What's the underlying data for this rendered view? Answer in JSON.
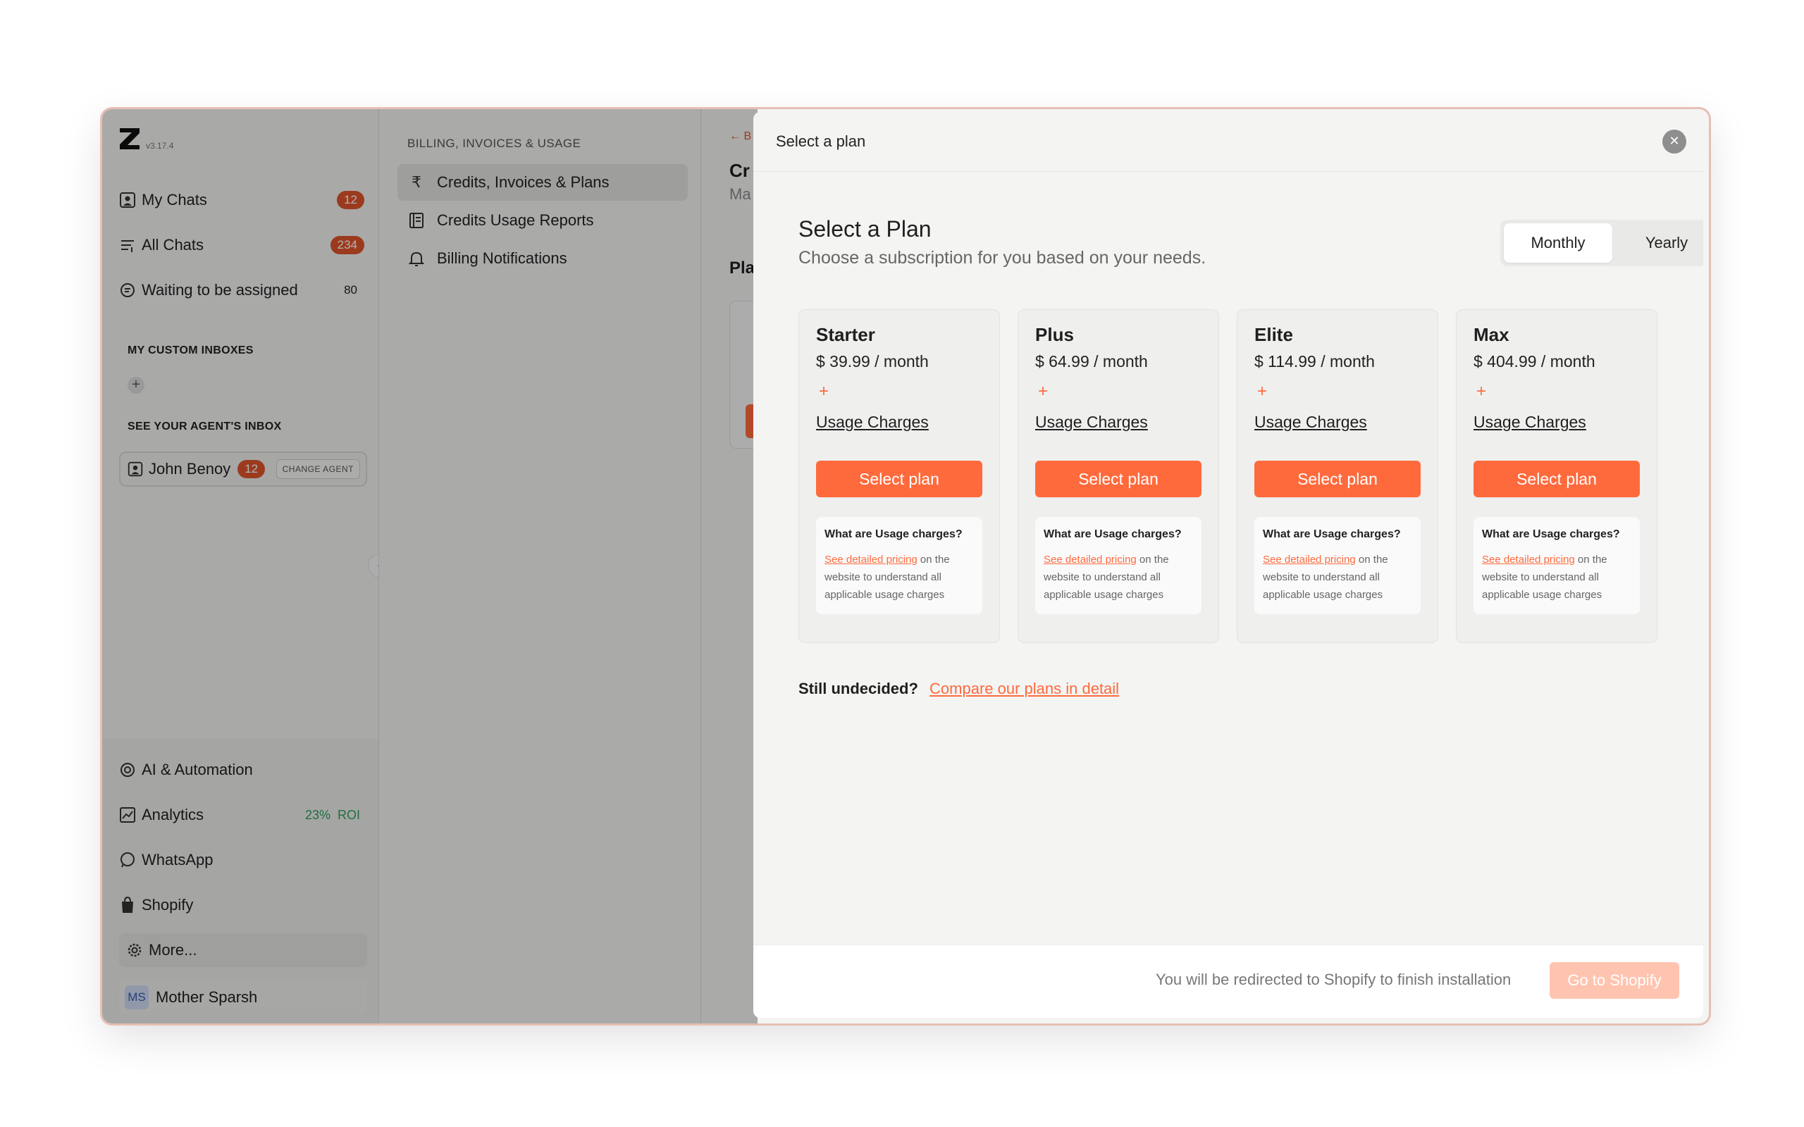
{
  "app": {
    "version": "v3.17.4"
  },
  "sidebar": {
    "items": [
      {
        "label": "My Chats",
        "badge": "12"
      },
      {
        "label": "All Chats",
        "badge": "234"
      },
      {
        "label": "Waiting to be assigned",
        "badge": "80"
      }
    ],
    "custom_inboxes_title": "MY CUSTOM INBOXES",
    "agent_inbox_title": "SEE YOUR AGENT'S INBOX",
    "agent": {
      "name": "John Benoy",
      "badge": "12",
      "change_label": "CHANGE AGENT"
    },
    "bottom_items": [
      {
        "label": "AI & Automation"
      },
      {
        "label": "Analytics",
        "roi_value": "23%",
        "roi_label": "ROI"
      },
      {
        "label": "WhatsApp"
      },
      {
        "label": "Shopify"
      },
      {
        "label": "More..."
      }
    ],
    "profile": {
      "initials": "MS",
      "name": "Mother Sparsh"
    }
  },
  "billing": {
    "header": "BILLING, INVOICES & USAGE",
    "items": [
      {
        "label": "Credits, Invoices & Plans",
        "icon": "rupee-icon"
      },
      {
        "label": "Credits Usage Reports",
        "icon": "report-icon"
      },
      {
        "label": "Billing Notifications",
        "icon": "bell-icon"
      }
    ]
  },
  "peek": {
    "back": "← B",
    "title": "Cr",
    "sub": "Ma",
    "plans": "Pla"
  },
  "modal": {
    "title": "Select a plan",
    "heading": "Select a Plan",
    "subheading": "Choose a subscription for you based on your needs.",
    "toggle": {
      "monthly": "Monthly",
      "yearly": "Yearly",
      "selected": "Monthly"
    },
    "plans": [
      {
        "name": "Starter",
        "price": "$ 39.99 / month"
      },
      {
        "name": "Plus",
        "price": "$ 64.99 / month"
      },
      {
        "name": "Elite",
        "price": "$ 114.99 / month"
      },
      {
        "name": "Max",
        "price": "$ 404.99 / month"
      }
    ],
    "plan_common": {
      "plus_sign": "+",
      "usage_label": "Usage Charges",
      "select_label": "Select plan",
      "info_question": "What are Usage charges?",
      "info_link": "See detailed pricing",
      "info_text": " on the website to understand all applicable usage charges"
    },
    "undecided": "Still undecided?",
    "compare_link": "Compare our plans in detail",
    "footer_text": "You will be redirected to Shopify to finish installation",
    "footer_button": "Go to Shopify"
  },
  "colors": {
    "accent": "#ff6a3d",
    "badge": "#e0542b",
    "roi": "#2e9e5b"
  }
}
